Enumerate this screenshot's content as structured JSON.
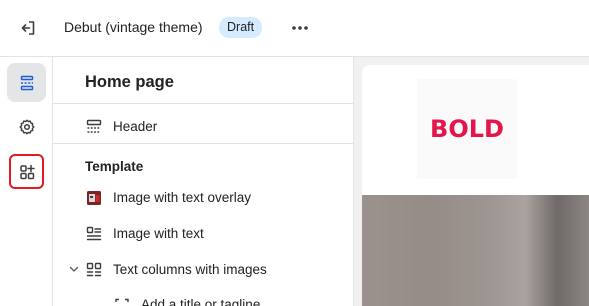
{
  "topbar": {
    "exit_icon": "exit-icon",
    "theme_name": "Debut (vintage theme)",
    "status_badge": "Draft",
    "more_icon": "more-horizontal-icon"
  },
  "rail": {
    "items": [
      {
        "icon": "sections-icon",
        "active": true
      },
      {
        "icon": "gear-icon",
        "active": false
      },
      {
        "icon": "app-blocks-icon",
        "highlighted": true
      }
    ]
  },
  "panel": {
    "title": "Home page",
    "header_item": {
      "label": "Header",
      "icon": "header-layout-icon"
    },
    "template_label": "Template",
    "template_items": [
      {
        "label": "Image with text overlay",
        "icon": "image-overlay-icon"
      },
      {
        "label": "Image with text",
        "icon": "image-text-icon"
      },
      {
        "label": "Text columns with images",
        "icon": "columns-icon",
        "expanded": true
      },
      {
        "label": "Add a title or tagline",
        "icon": "text-block-icon"
      }
    ]
  },
  "preview": {
    "logo_text": "BOLD",
    "colors": {
      "logo": "#e3154b",
      "badge": "#d5ebff",
      "highlight": "#e01b24"
    }
  }
}
